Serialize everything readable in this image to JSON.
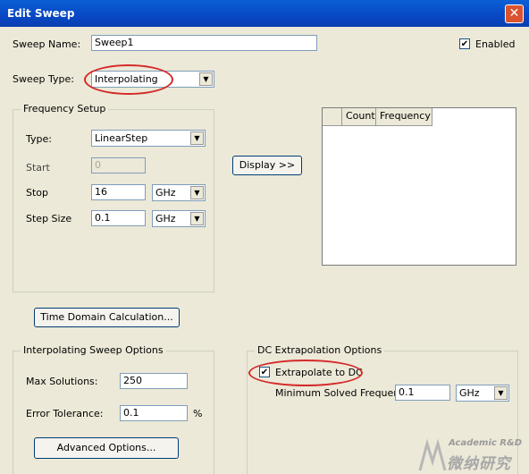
{
  "window": {
    "title": "Edit Sweep",
    "close_glyph": "✕"
  },
  "sweep_name": {
    "label": "Sweep Name:",
    "value": "Sweep1"
  },
  "enabled": {
    "label": "Enabled",
    "checked": true,
    "check_glyph": "✔"
  },
  "sweep_type": {
    "label": "Sweep Type:",
    "value": "Interpolating",
    "arrow": "▼"
  },
  "frequency_setup": {
    "title": "Frequency Setup",
    "type": {
      "label": "Type:",
      "value": "LinearStep"
    },
    "start": {
      "label": "Start",
      "value": "0"
    },
    "stop": {
      "label": "Stop",
      "value": "16",
      "unit": "GHz"
    },
    "step": {
      "label": "Step Size",
      "value": "0.1",
      "unit": "GHz"
    }
  },
  "display_button": "Display >>",
  "table": {
    "columns": [
      "Count",
      "Frequency"
    ]
  },
  "time_domain_button": "Time Domain Calculation...",
  "interp_options": {
    "title": "Interpolating Sweep Options",
    "max_solutions": {
      "label": "Max Solutions:",
      "value": "250"
    },
    "error_tolerance": {
      "label": "Error Tolerance:",
      "value": "0.1",
      "unit": "%"
    },
    "advanced_button": "Advanced Options..."
  },
  "dc_options": {
    "title": "DC Extrapolation Options",
    "extrapolate": {
      "label": "Extrapolate to DC",
      "checked": true
    },
    "min_freq": {
      "label": "Minimum Solved Frequency",
      "value": "0.1",
      "unit": "GHz"
    }
  },
  "watermark": {
    "text": "Academic R&D",
    "icon": " ",
    "chars": "微纳研究"
  }
}
